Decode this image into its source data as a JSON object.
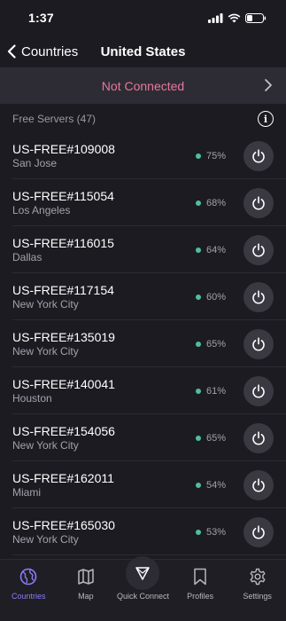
{
  "status_bar": {
    "time": "1:37"
  },
  "nav": {
    "back_label": "Countries",
    "title": "United States"
  },
  "banner": {
    "text": "Not Connected"
  },
  "section": {
    "title": "Free Servers (47)"
  },
  "servers": [
    {
      "name": "US-FREE#109008",
      "city": "San Jose",
      "load": "75%"
    },
    {
      "name": "US-FREE#115054",
      "city": "Los Angeles",
      "load": "68%"
    },
    {
      "name": "US-FREE#116015",
      "city": "Dallas",
      "load": "64%"
    },
    {
      "name": "US-FREE#117154",
      "city": "New York City",
      "load": "60%"
    },
    {
      "name": "US-FREE#135019",
      "city": "New York City",
      "load": "65%"
    },
    {
      "name": "US-FREE#140041",
      "city": "Houston",
      "load": "61%"
    },
    {
      "name": "US-FREE#154056",
      "city": "New York City",
      "load": "65%"
    },
    {
      "name": "US-FREE#162011",
      "city": "Miami",
      "load": "54%"
    },
    {
      "name": "US-FREE#165030",
      "city": "New York City",
      "load": "53%"
    }
  ],
  "tabs": [
    {
      "label": "Countries",
      "icon": "globe-icon",
      "active": true
    },
    {
      "label": "Map",
      "icon": "map-icon"
    },
    {
      "label": "Quick Connect",
      "icon": "quick-connect-icon"
    },
    {
      "label": "Profiles",
      "icon": "bookmark-icon"
    },
    {
      "label": "Settings",
      "icon": "gear-icon"
    }
  ],
  "colors": {
    "background": "#1c1b22",
    "banner_background": "#2d2c35",
    "not_connected": "#e8779a",
    "load_indicator": "#4fbf9e",
    "active_tab": "#8a7cf7"
  }
}
